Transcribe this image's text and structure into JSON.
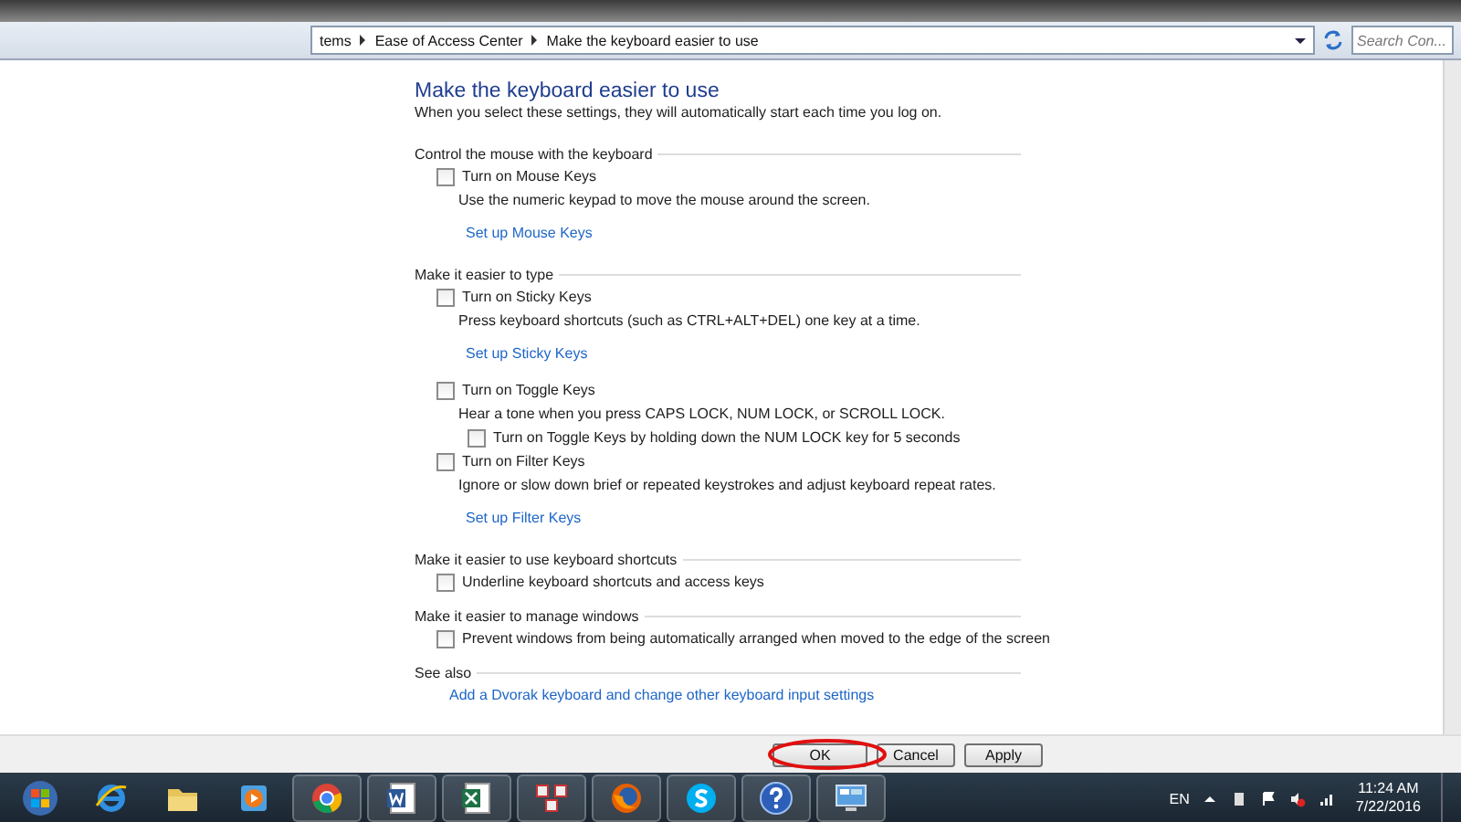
{
  "address_bar": {
    "breadcrumbs": [
      "tems",
      "Ease of Access Center",
      "Make the keyboard easier to use"
    ],
    "search": {
      "placeholder": "Search Con..."
    }
  },
  "page": {
    "title": "Make the keyboard easier to use",
    "subtitle": "When you select these settings, they will automatically start each time you log on.",
    "sections": [
      {
        "heading": "Control the mouse with the keyboard",
        "items": [
          {
            "kind": "checkbox",
            "label": "Turn on Mouse Keys",
            "checked": false
          },
          {
            "kind": "description",
            "label": "Use the numeric keypad to move the mouse around the screen."
          },
          {
            "kind": "link",
            "label": "Set up Mouse Keys"
          }
        ]
      },
      {
        "heading": "Make it easier to type",
        "items": [
          {
            "kind": "checkbox",
            "label": "Turn on Sticky Keys",
            "checked": false
          },
          {
            "kind": "description",
            "label": "Press keyboard shortcuts (such as CTRL+ALT+DEL) one key at a time."
          },
          {
            "kind": "link",
            "label": "Set up Sticky Keys"
          },
          {
            "kind": "checkbox",
            "label": "Turn on Toggle Keys",
            "checked": false
          },
          {
            "kind": "description",
            "label": "Hear a tone when you press CAPS LOCK, NUM LOCK, or SCROLL LOCK."
          },
          {
            "kind": "subcheckbox",
            "label": "Turn on Toggle Keys by holding down the NUM LOCK key for 5 seconds",
            "checked": false
          },
          {
            "kind": "checkbox",
            "label": "Turn on Filter Keys",
            "checked": false
          },
          {
            "kind": "description",
            "label": "Ignore or slow down brief or repeated keystrokes and adjust keyboard repeat rates."
          },
          {
            "kind": "link",
            "label": "Set up Filter Keys"
          }
        ]
      },
      {
        "heading": "Make it easier to use keyboard shortcuts",
        "items": [
          {
            "kind": "checkbox",
            "label": "Underline keyboard shortcuts and access keys",
            "checked": false
          }
        ]
      },
      {
        "heading": "Make it easier to manage windows",
        "items": [
          {
            "kind": "checkbox",
            "label": "Prevent windows from being automatically arranged when moved to the edge of the screen",
            "checked": false
          }
        ]
      },
      {
        "heading": "See also",
        "items": [
          {
            "kind": "seealso",
            "label": "Add a Dvorak keyboard and change other keyboard input settings"
          }
        ]
      }
    ]
  },
  "buttons": [
    "OK",
    "Cancel",
    "Apply"
  ],
  "taskbar": {
    "apps": [
      {
        "kind": "start"
      },
      {
        "kind": "ie"
      },
      {
        "kind": "folder"
      },
      {
        "kind": "media"
      },
      {
        "kind": "chrome"
      },
      {
        "kind": "word"
      },
      {
        "kind": "excel"
      },
      {
        "kind": "network"
      },
      {
        "kind": "firefox"
      },
      {
        "kind": "skype"
      },
      {
        "kind": "help"
      },
      {
        "kind": "control"
      }
    ],
    "language": "EN",
    "time": "11:24 AM",
    "date": "7/22/2016"
  }
}
